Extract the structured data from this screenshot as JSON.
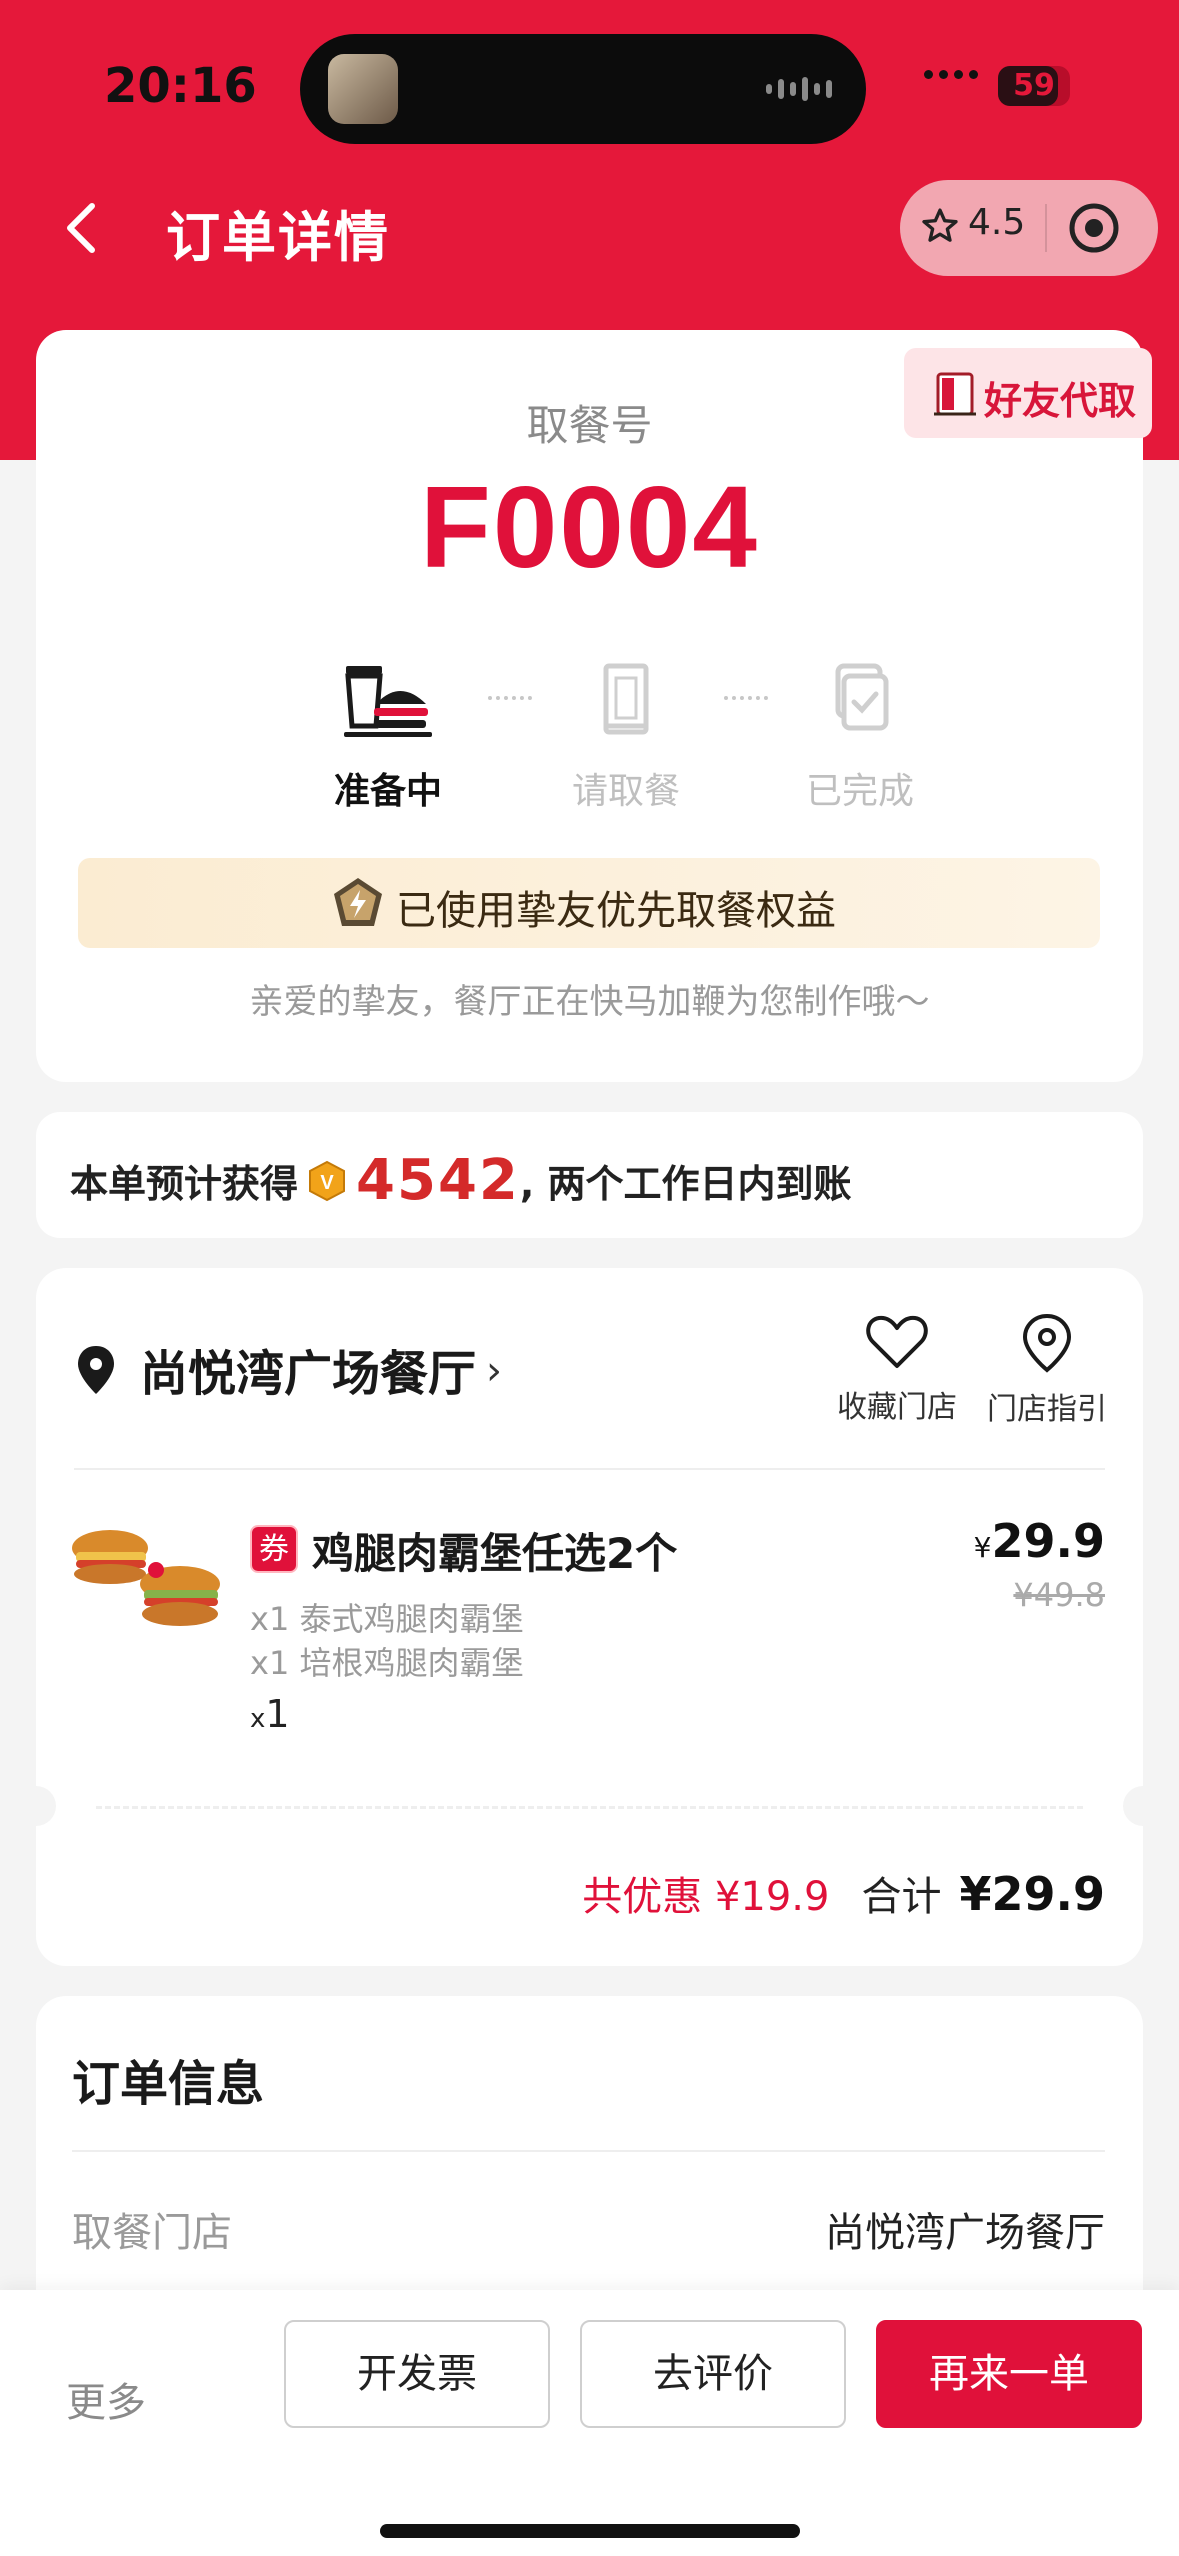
{
  "status_bar": {
    "time": "20:16",
    "battery": "59"
  },
  "nav": {
    "title": "订单详情",
    "rating": "4.5"
  },
  "order": {
    "friend_pickup": "好友代取",
    "pickup_label": "取餐号",
    "pickup_code": "F0004",
    "steps": [
      {
        "label": "准备中",
        "state": "active"
      },
      {
        "label": "请取餐",
        "state": "inactive"
      },
      {
        "label": "已完成",
        "state": "inactive"
      }
    ],
    "benefit": "已使用挚友优先取餐权益",
    "hint": "亲爱的挚友，餐厅正在快马加鞭为您制作哦～"
  },
  "points": {
    "prefix": "本单预计获得",
    "badge": "V",
    "value": "4542",
    "suffix": ", 两个工作日内到账"
  },
  "store": {
    "name": "尚悦湾广场餐厅",
    "chevron": "›",
    "favorite_label": "收藏门店",
    "guide_label": "门店指引"
  },
  "product": {
    "coupon_tag": "券",
    "title": "鸡腿肉霸堡任选2个",
    "items": [
      "x1 泰式鸡腿肉霸堡",
      "x1 培根鸡腿肉霸堡"
    ],
    "qty_prefix": "x",
    "qty": "1",
    "currency": "¥",
    "price": "29.9",
    "original_price": "¥49.8"
  },
  "totals": {
    "discount": "共优惠 ¥19.9",
    "total_label": "合计",
    "total_value": "¥29.9"
  },
  "order_info": {
    "title": "订单信息",
    "pickup_store_key": "取餐门店",
    "pickup_store_value": "尚悦湾广场餐厅"
  },
  "bottom_bar": {
    "more": "更多",
    "invoice": "开发票",
    "review": "去评价",
    "reorder": "再来一单"
  },
  "colors": {
    "brand_red": "#e0113a",
    "header_red": "#e5183a"
  }
}
